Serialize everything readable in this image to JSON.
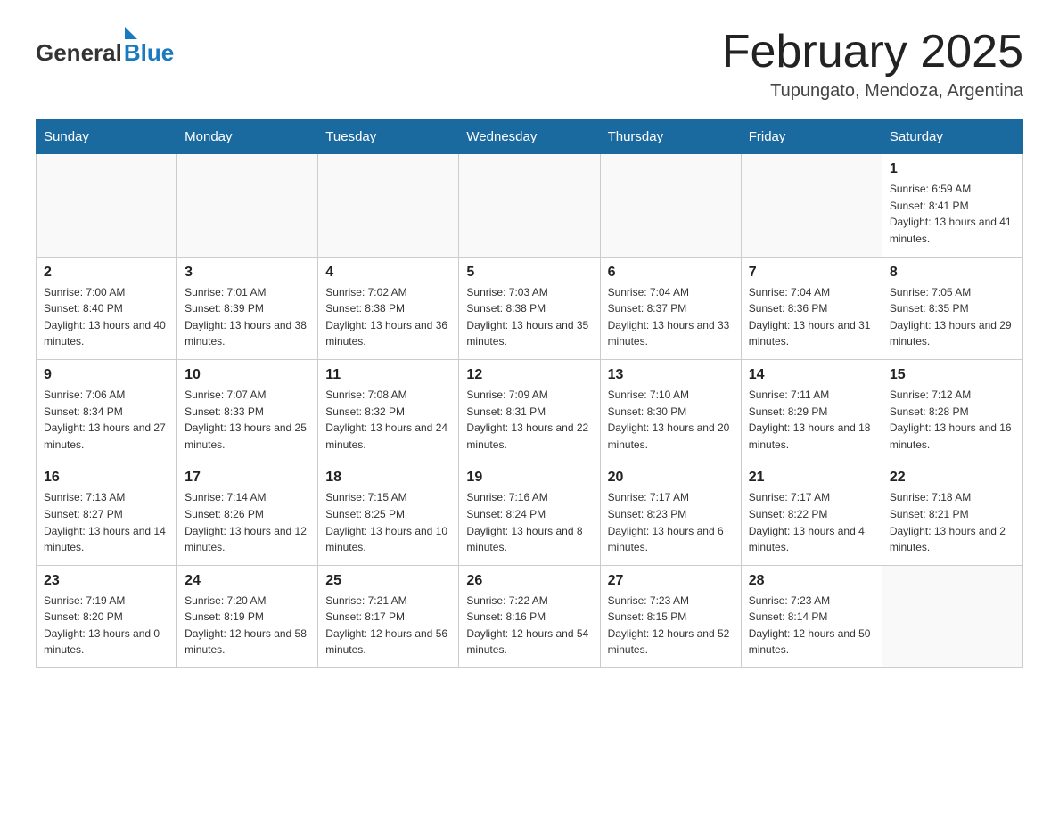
{
  "logo": {
    "general": "General",
    "blue": "Blue",
    "triangle_color": "#1a7abf"
  },
  "title": "February 2025",
  "subtitle": "Tupungato, Mendoza, Argentina",
  "weekdays": [
    "Sunday",
    "Monday",
    "Tuesday",
    "Wednesday",
    "Thursday",
    "Friday",
    "Saturday"
  ],
  "weeks": [
    [
      {
        "day": "",
        "info": ""
      },
      {
        "day": "",
        "info": ""
      },
      {
        "day": "",
        "info": ""
      },
      {
        "day": "",
        "info": ""
      },
      {
        "day": "",
        "info": ""
      },
      {
        "day": "",
        "info": ""
      },
      {
        "day": "1",
        "info": "Sunrise: 6:59 AM\nSunset: 8:41 PM\nDaylight: 13 hours and 41 minutes."
      }
    ],
    [
      {
        "day": "2",
        "info": "Sunrise: 7:00 AM\nSunset: 8:40 PM\nDaylight: 13 hours and 40 minutes."
      },
      {
        "day": "3",
        "info": "Sunrise: 7:01 AM\nSunset: 8:39 PM\nDaylight: 13 hours and 38 minutes."
      },
      {
        "day": "4",
        "info": "Sunrise: 7:02 AM\nSunset: 8:38 PM\nDaylight: 13 hours and 36 minutes."
      },
      {
        "day": "5",
        "info": "Sunrise: 7:03 AM\nSunset: 8:38 PM\nDaylight: 13 hours and 35 minutes."
      },
      {
        "day": "6",
        "info": "Sunrise: 7:04 AM\nSunset: 8:37 PM\nDaylight: 13 hours and 33 minutes."
      },
      {
        "day": "7",
        "info": "Sunrise: 7:04 AM\nSunset: 8:36 PM\nDaylight: 13 hours and 31 minutes."
      },
      {
        "day": "8",
        "info": "Sunrise: 7:05 AM\nSunset: 8:35 PM\nDaylight: 13 hours and 29 minutes."
      }
    ],
    [
      {
        "day": "9",
        "info": "Sunrise: 7:06 AM\nSunset: 8:34 PM\nDaylight: 13 hours and 27 minutes."
      },
      {
        "day": "10",
        "info": "Sunrise: 7:07 AM\nSunset: 8:33 PM\nDaylight: 13 hours and 25 minutes."
      },
      {
        "day": "11",
        "info": "Sunrise: 7:08 AM\nSunset: 8:32 PM\nDaylight: 13 hours and 24 minutes."
      },
      {
        "day": "12",
        "info": "Sunrise: 7:09 AM\nSunset: 8:31 PM\nDaylight: 13 hours and 22 minutes."
      },
      {
        "day": "13",
        "info": "Sunrise: 7:10 AM\nSunset: 8:30 PM\nDaylight: 13 hours and 20 minutes."
      },
      {
        "day": "14",
        "info": "Sunrise: 7:11 AM\nSunset: 8:29 PM\nDaylight: 13 hours and 18 minutes."
      },
      {
        "day": "15",
        "info": "Sunrise: 7:12 AM\nSunset: 8:28 PM\nDaylight: 13 hours and 16 minutes."
      }
    ],
    [
      {
        "day": "16",
        "info": "Sunrise: 7:13 AM\nSunset: 8:27 PM\nDaylight: 13 hours and 14 minutes."
      },
      {
        "day": "17",
        "info": "Sunrise: 7:14 AM\nSunset: 8:26 PM\nDaylight: 13 hours and 12 minutes."
      },
      {
        "day": "18",
        "info": "Sunrise: 7:15 AM\nSunset: 8:25 PM\nDaylight: 13 hours and 10 minutes."
      },
      {
        "day": "19",
        "info": "Sunrise: 7:16 AM\nSunset: 8:24 PM\nDaylight: 13 hours and 8 minutes."
      },
      {
        "day": "20",
        "info": "Sunrise: 7:17 AM\nSunset: 8:23 PM\nDaylight: 13 hours and 6 minutes."
      },
      {
        "day": "21",
        "info": "Sunrise: 7:17 AM\nSunset: 8:22 PM\nDaylight: 13 hours and 4 minutes."
      },
      {
        "day": "22",
        "info": "Sunrise: 7:18 AM\nSunset: 8:21 PM\nDaylight: 13 hours and 2 minutes."
      }
    ],
    [
      {
        "day": "23",
        "info": "Sunrise: 7:19 AM\nSunset: 8:20 PM\nDaylight: 13 hours and 0 minutes."
      },
      {
        "day": "24",
        "info": "Sunrise: 7:20 AM\nSunset: 8:19 PM\nDaylight: 12 hours and 58 minutes."
      },
      {
        "day": "25",
        "info": "Sunrise: 7:21 AM\nSunset: 8:17 PM\nDaylight: 12 hours and 56 minutes."
      },
      {
        "day": "26",
        "info": "Sunrise: 7:22 AM\nSunset: 8:16 PM\nDaylight: 12 hours and 54 minutes."
      },
      {
        "day": "27",
        "info": "Sunrise: 7:23 AM\nSunset: 8:15 PM\nDaylight: 12 hours and 52 minutes."
      },
      {
        "day": "28",
        "info": "Sunrise: 7:23 AM\nSunset: 8:14 PM\nDaylight: 12 hours and 50 minutes."
      },
      {
        "day": "",
        "info": ""
      }
    ]
  ]
}
